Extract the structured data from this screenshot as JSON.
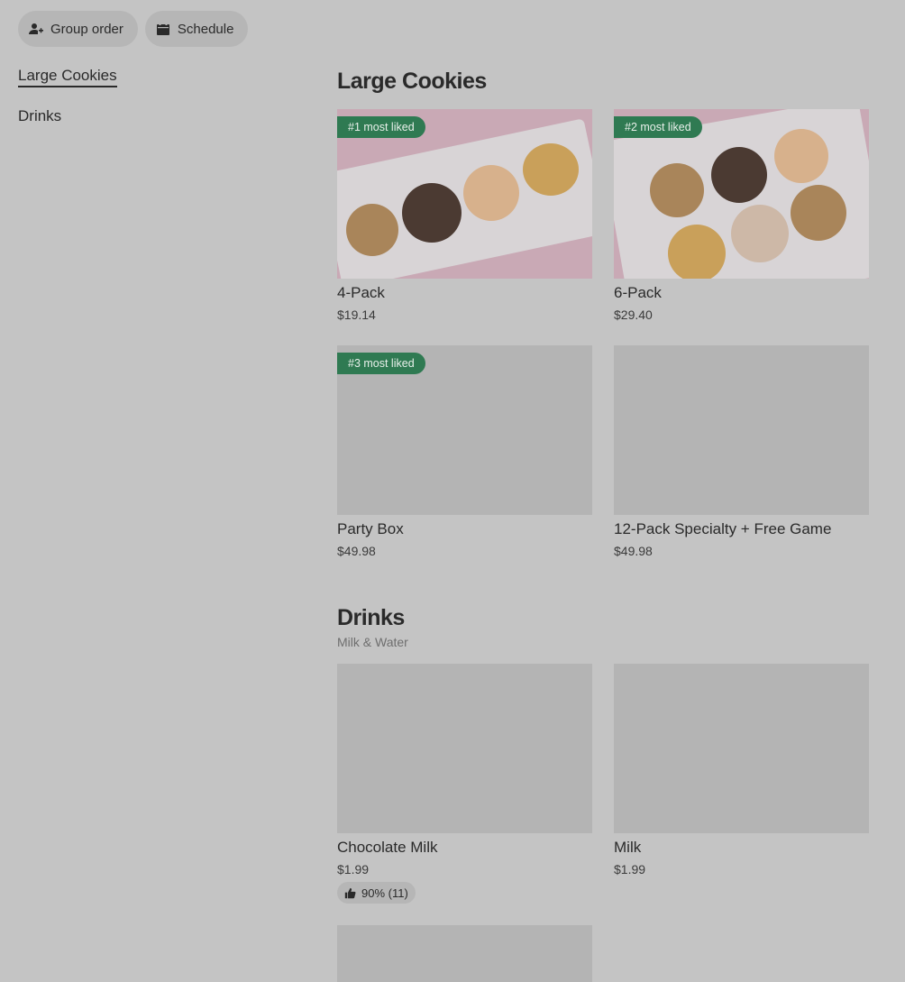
{
  "topbar": {
    "group_order": {
      "label": "Group order",
      "icon": "person-add-icon"
    },
    "schedule": {
      "label": "Schedule",
      "icon": "calendar-icon"
    }
  },
  "sidenav": {
    "items": [
      {
        "label": "Large Cookies",
        "active": true
      },
      {
        "label": "Drinks",
        "active": false
      }
    ]
  },
  "sections": [
    {
      "title": "Large Cookies",
      "subtitle": "",
      "items": [
        {
          "name": "4-Pack",
          "price": "$19.14",
          "badge": "#1 most liked"
        },
        {
          "name": "6-Pack",
          "price": "$29.40",
          "badge": "#2 most liked"
        },
        {
          "name": "Party Box",
          "price": "$49.98",
          "badge": "#3 most liked"
        },
        {
          "name": "12-Pack Specialty + Free Game",
          "price": "$49.98",
          "badge": ""
        }
      ]
    },
    {
      "title": "Drinks",
      "subtitle": "Milk & Water",
      "items": [
        {
          "name": "Chocolate Milk",
          "price": "$1.99",
          "rating": "90% (11)"
        },
        {
          "name": "Milk",
          "price": "$1.99"
        }
      ]
    }
  ],
  "colors": {
    "overlay_bg": "#c4c4c4",
    "badge_green": "#2f7a52",
    "placeholder": "#b4b4b4"
  }
}
